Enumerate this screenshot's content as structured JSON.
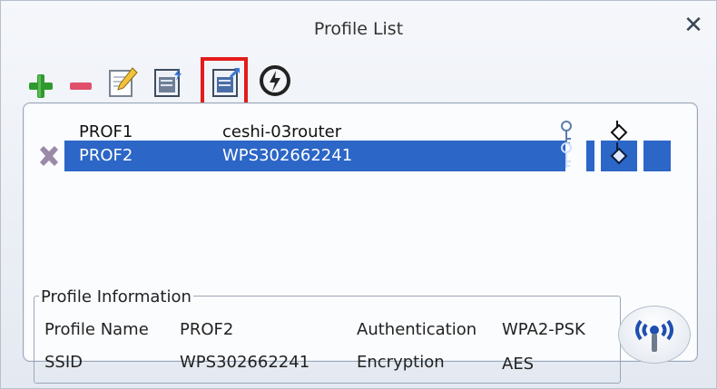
{
  "window": {
    "title": "Profile List",
    "close_glyph": "✕"
  },
  "toolbar": {
    "items": [
      {
        "name": "add-profile-icon",
        "color": "#2e9a2e"
      },
      {
        "name": "remove-profile-icon",
        "color": "#e0506a"
      },
      {
        "name": "edit-profile-icon"
      },
      {
        "name": "import-profile-icon"
      },
      {
        "name": "export-profile-icon"
      },
      {
        "name": "activate-profile-icon"
      }
    ]
  },
  "profiles": [
    {
      "name": "PROF1",
      "ssid": "ceshi-03router",
      "selected": false
    },
    {
      "name": "PROF2",
      "ssid": "WPS302662241",
      "selected": true
    }
  ],
  "profile_info": {
    "legend": "Profile Information",
    "profile_name_label": "Profile Name",
    "profile_name_value": "PROF2",
    "ssid_label": "SSID",
    "ssid_value": "WPS302662241",
    "authentication_label": "Authentication",
    "authentication_value": "WPA2-PSK",
    "encryption_label": "Encryption",
    "encryption_value": "AES"
  },
  "colors": {
    "selection": "#2c66c7",
    "highlight_border": "#e31b1b"
  }
}
